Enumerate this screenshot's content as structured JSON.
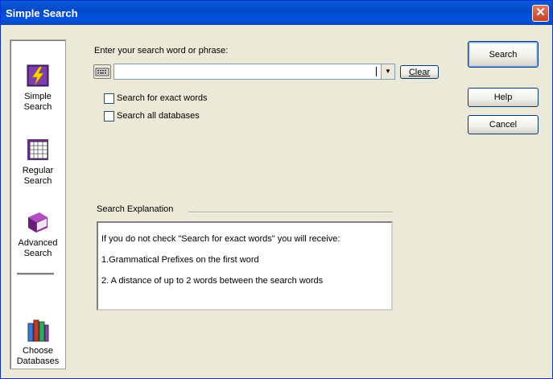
{
  "window": {
    "title": "Simple Search",
    "close_glyph": "✕"
  },
  "nav": {
    "items": [
      {
        "line1": "Simple",
        "line2": "Search",
        "icon": "lightning-book-icon"
      },
      {
        "line1": "Regular",
        "line2": "Search",
        "icon": "grid-book-icon"
      },
      {
        "line1": "Advanced",
        "line2": "Search",
        "icon": "purple-book-icon"
      },
      {
        "line1": "Choose",
        "line2": "Databases",
        "icon": "books-icon"
      }
    ]
  },
  "search": {
    "prompt": "Enter your search word or phrase:",
    "value": "",
    "clear_label": "Clear",
    "exact_words_label": "Search for exact words",
    "all_databases_label": "Search all databases"
  },
  "buttons": {
    "search": "Search",
    "help": "Help",
    "cancel": "Cancel"
  },
  "explanation": {
    "title": "Search Explanation",
    "lines": [
      "If you do not check \"Search for exact words\" you will receive:",
      "1.Grammatical Prefixes on the first word",
      "2. A distance of up to 2 words between the search words"
    ]
  }
}
